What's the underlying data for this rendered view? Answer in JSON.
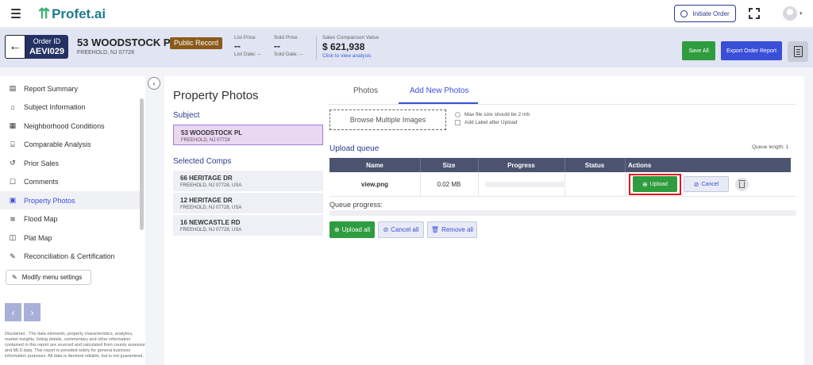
{
  "app": {
    "logo_text": "Profet.ai",
    "initiate_order": "Initiate Order"
  },
  "order": {
    "id_label": "Order ID",
    "id_value": "AEVI029",
    "address_line1": "53 WOODSTOCK PL",
    "address_line2": "FREEHOLD, NJ 07728",
    "badge": "Public Record",
    "list_price_label": "List Price",
    "list_price_value": "--",
    "list_date": "List Date: --",
    "sold_price_label": "Sold Price",
    "sold_price_value": "--",
    "sold_date": "Sold Date: --",
    "scv_label": "Sales Comparison Value",
    "scv_value": "$ 621,938",
    "scv_link": "Click to view analysis",
    "save_all": "Save All",
    "export_report": "Export Order Report"
  },
  "sidebar": {
    "items": [
      {
        "label": "Report Summary",
        "icon": "report-icon"
      },
      {
        "label": "Subject Information",
        "icon": "house-icon"
      },
      {
        "label": "Neighborhood Conditions",
        "icon": "neighborhood-icon"
      },
      {
        "label": "Comparable Analysis",
        "icon": "bank-icon"
      },
      {
        "label": "Prior Sales",
        "icon": "history-icon"
      },
      {
        "label": "Comments",
        "icon": "comment-icon"
      },
      {
        "label": "Property Photos",
        "icon": "photo-icon"
      },
      {
        "label": "Flood Map",
        "icon": "flood-icon"
      },
      {
        "label": "Plat Map",
        "icon": "map-icon"
      },
      {
        "label": "Reconciliation & Certification",
        "icon": "certificate-icon"
      }
    ],
    "active_index": 6,
    "modify_menu": "Modify menu settings",
    "disclaimer": "Disclaimer : The data elements, property characteristics, analytics, market insights, listing details, commentary and other information contained in this report are sourced and calculated from county assessor and MLS data. This report is provided solely for general business information purposes. All data is deemed reliable, but is not guaranteed."
  },
  "photos": {
    "title": "Property Photos",
    "tabs": [
      "Photos",
      "Add New Photos"
    ],
    "active_tab": 1,
    "subject_heading": "Subject",
    "subject": {
      "name": "53 WOODSTOCK PL",
      "address": "FREEHOLD, NJ 07728"
    },
    "selected_heading": "Selected Comps",
    "comps": [
      {
        "name": "66 HERITAGE DR",
        "address": "FREEHOLD, NJ 07728, USA"
      },
      {
        "name": "12 HERITAGE DR",
        "address": "FREEHOLD, NJ 07728, USA"
      },
      {
        "name": "16 NEWCASTLE RD",
        "address": "FREEHOLD, NJ 07728, USA"
      }
    ],
    "browse_label": "Browse Multiple Images",
    "max_file_size": "Max file size should be 2 mb",
    "add_label_option": "Add Label after Upload",
    "upload_queue": "Upload queue",
    "queue_length": "Queue length: 1",
    "columns": [
      "Name",
      "Size",
      "Progress",
      "Status",
      "Actions"
    ],
    "rows": [
      {
        "name": "view.png",
        "size": "0.02 MB",
        "progress": 0,
        "status": ""
      }
    ],
    "upload": "Upload",
    "cancel": "Cancel",
    "queue_progress_label": "Queue progress:",
    "queue_progress": 0,
    "upload_all": "Upload all",
    "cancel_all": "Cancel all",
    "remove_all": "Remove all"
  },
  "colors": {
    "primary": "#3a4fd7",
    "success": "#2e9c3f",
    "navy": "#243263",
    "highlight": "#e2101a"
  }
}
